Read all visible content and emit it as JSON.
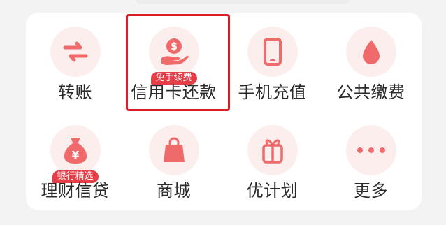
{
  "colors": {
    "accent": "#ef6a6a",
    "icon_bg": "#fdeeee",
    "badge_bg": "#e53e46",
    "highlight_border": "#d71e26"
  },
  "services": [
    {
      "label": "转账",
      "icon": "transfer-arrows-icon"
    },
    {
      "label": "信用卡还款",
      "icon": "hand-coin-icon",
      "badge": "免手续费",
      "highlighted": true
    },
    {
      "label": "手机充值",
      "icon": "mobile-phone-icon"
    },
    {
      "label": "公共缴费",
      "icon": "water-drop-icon"
    },
    {
      "label": "理财信贷",
      "icon": "money-bag-icon",
      "badge": "银行精选"
    },
    {
      "label": "商城",
      "icon": "shopping-bag-icon"
    },
    {
      "label": "优计划",
      "icon": "gift-icon"
    },
    {
      "label": "更多",
      "icon": "more-dots-icon"
    }
  ]
}
